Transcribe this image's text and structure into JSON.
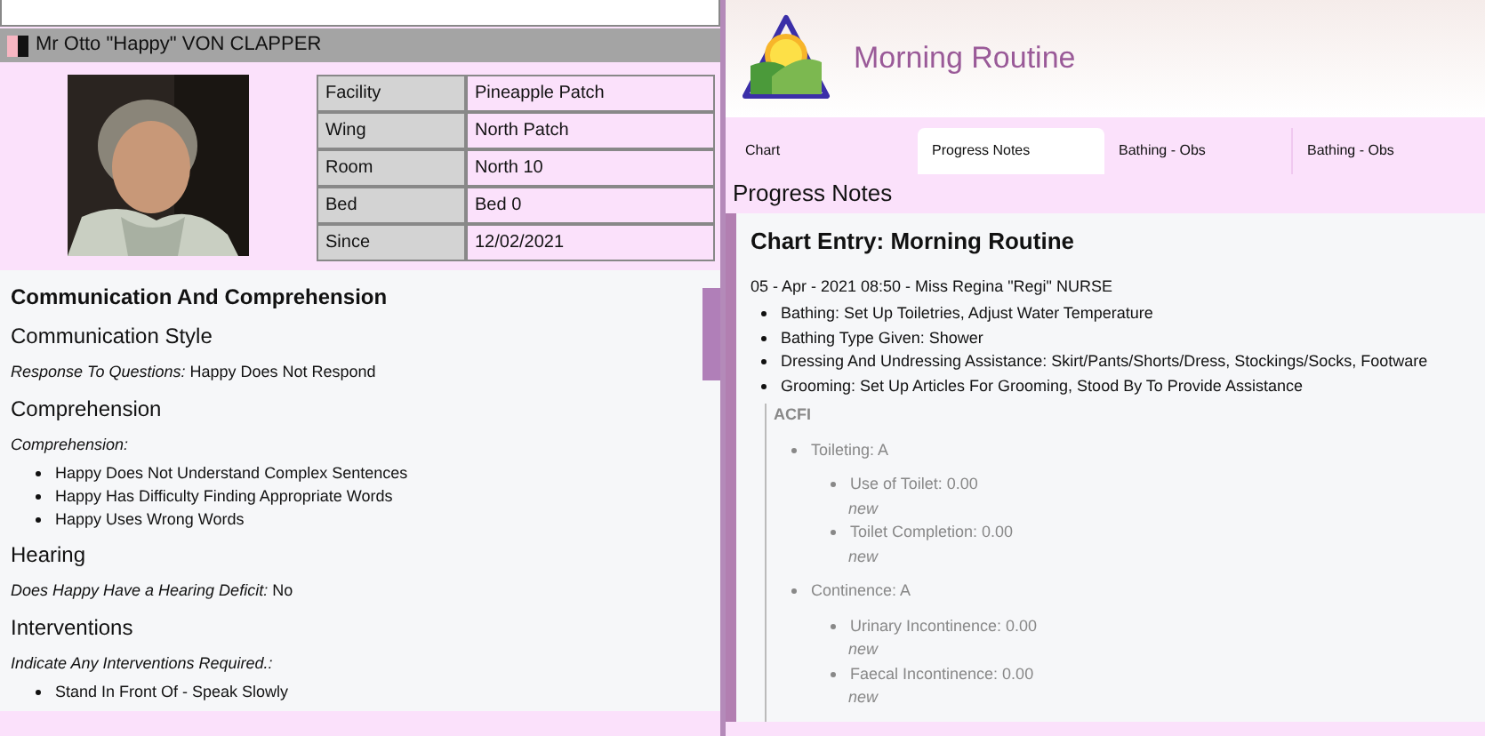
{
  "resident": {
    "name": "Mr  Otto \"Happy\" VON CLAPPER",
    "details": [
      {
        "label": "Facility",
        "value": "Pineapple Patch"
      },
      {
        "label": "Wing",
        "value": "North Patch"
      },
      {
        "label": "Room",
        "value": "North  10"
      },
      {
        "label": "Bed",
        "value": "Bed 0"
      },
      {
        "label": "Since",
        "value": "12/02/2021"
      }
    ]
  },
  "assessment": {
    "title": "Communication And Comprehension",
    "sections": [
      {
        "heading": "Communication Style",
        "question": "Response To Questions:",
        "answer": "Happy Does Not Respond"
      },
      {
        "heading": "Comprehension",
        "question": "Comprehension:",
        "items": [
          "Happy Does Not Understand Complex Sentences",
          "Happy Has Difficulty Finding Appropriate Words",
          "Happy Uses Wrong Words"
        ]
      },
      {
        "heading": "Hearing",
        "question": "Does Happy Have a Hearing Deficit:",
        "answer": "No"
      },
      {
        "heading": "Interventions",
        "question": "Indicate Any Interventions Required.:",
        "items": [
          "Stand In Front Of - Speak Slowly"
        ]
      }
    ]
  },
  "app": {
    "title": "Morning Routine"
  },
  "tabs": [
    {
      "label": "Chart",
      "selected": false
    },
    {
      "label": "Progress Notes",
      "selected": true
    },
    {
      "label": "Bathing - Obs",
      "selected": false
    },
    {
      "label": "Bathing - Obs",
      "selected": false
    }
  ],
  "progress_notes": {
    "heading": "Progress Notes",
    "entry_title": "Chart Entry: Morning Routine",
    "meta": "05 - Apr - 2021 08:50 - Miss Regina \"Regi\" NURSE",
    "items": [
      "Bathing: Set Up Toiletries, Adjust Water Temperature",
      "Bathing Type Given: Shower",
      "Dressing And Undressing Assistance: Skirt/Pants/Shorts/Dress, Stockings/Socks, Footware",
      "Grooming: Set Up Articles For Grooming, Stood By To Provide Assistance"
    ],
    "acfi": {
      "title": "ACFI",
      "groups": [
        {
          "label": "Toileting: A",
          "children": [
            {
              "label": "Use of Toilet: 0.00",
              "note": "new"
            },
            {
              "label": "Toilet Completion: 0.00",
              "note": "new"
            }
          ]
        },
        {
          "label": "Continence: A",
          "children": [
            {
              "label": "Urinary Incontinence: 0.00",
              "note": "new"
            },
            {
              "label": "Faecal Incontinence: 0.00",
              "note": "new"
            }
          ]
        }
      ]
    }
  }
}
